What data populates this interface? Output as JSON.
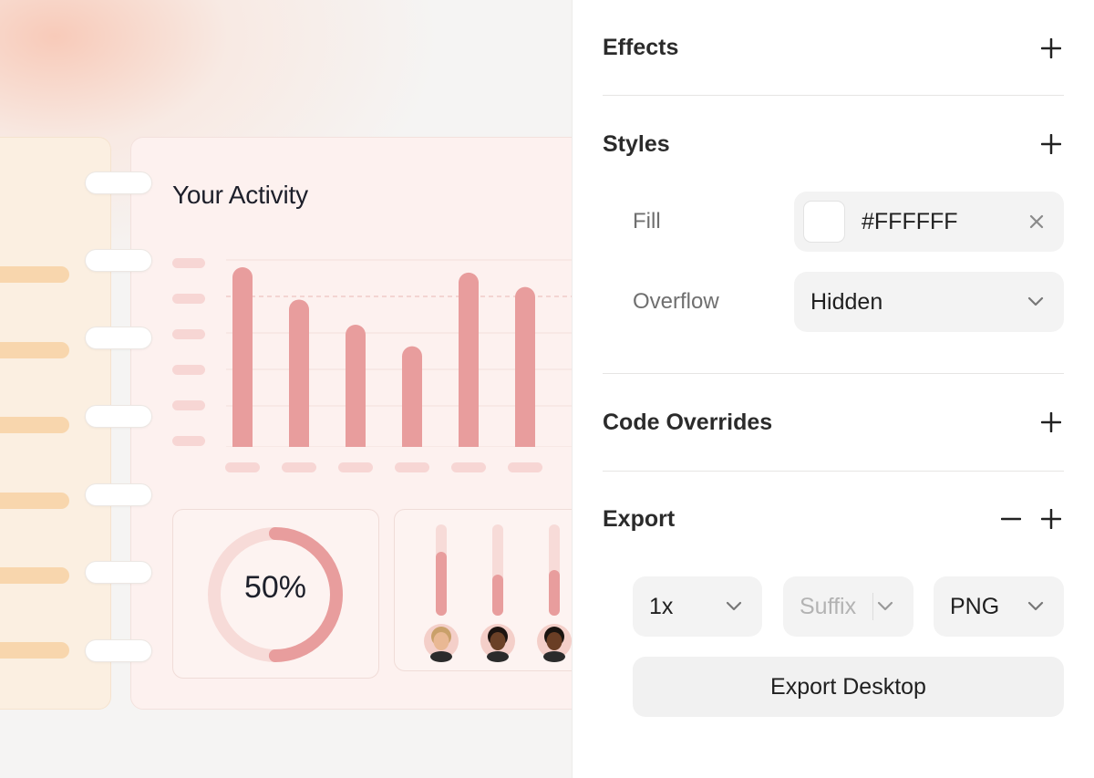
{
  "canvas": {
    "activity_title": "Your Activity",
    "chart_data": {
      "type": "bar",
      "values": [
        100,
        82,
        68,
        56,
        97,
        89
      ],
      "color": "#e89d9d"
    },
    "donut": {
      "value": 0.5,
      "label": "50%",
      "color": "#e89d9d",
      "track_color": "#f7dbd8"
    },
    "sliders": [
      {
        "fill": 0.7,
        "avatar": "avatar-icon-1"
      },
      {
        "fill": 0.45,
        "avatar": "avatar-icon-2"
      },
      {
        "fill": 0.5,
        "avatar": "avatar-icon-3"
      }
    ]
  },
  "panel": {
    "effects": {
      "title": "Effects",
      "add_icon": "plus-icon"
    },
    "styles": {
      "title": "Styles",
      "add_icon": "plus-icon",
      "fill_label": "Fill",
      "fill_value": "#FFFFFF",
      "fill_swatch_color": "#FFFFFF",
      "clear_icon": "close-icon",
      "overflow_label": "Overflow",
      "overflow_value": "Hidden"
    },
    "code_overrides": {
      "title": "Code Overrides",
      "add_icon": "plus-icon"
    },
    "export": {
      "title": "Export",
      "remove_icon": "minus-icon",
      "add_icon": "plus-icon",
      "scale": "1x",
      "suffix_placeholder": "Suffix",
      "format": "PNG",
      "button_label": "Export Desktop"
    }
  }
}
